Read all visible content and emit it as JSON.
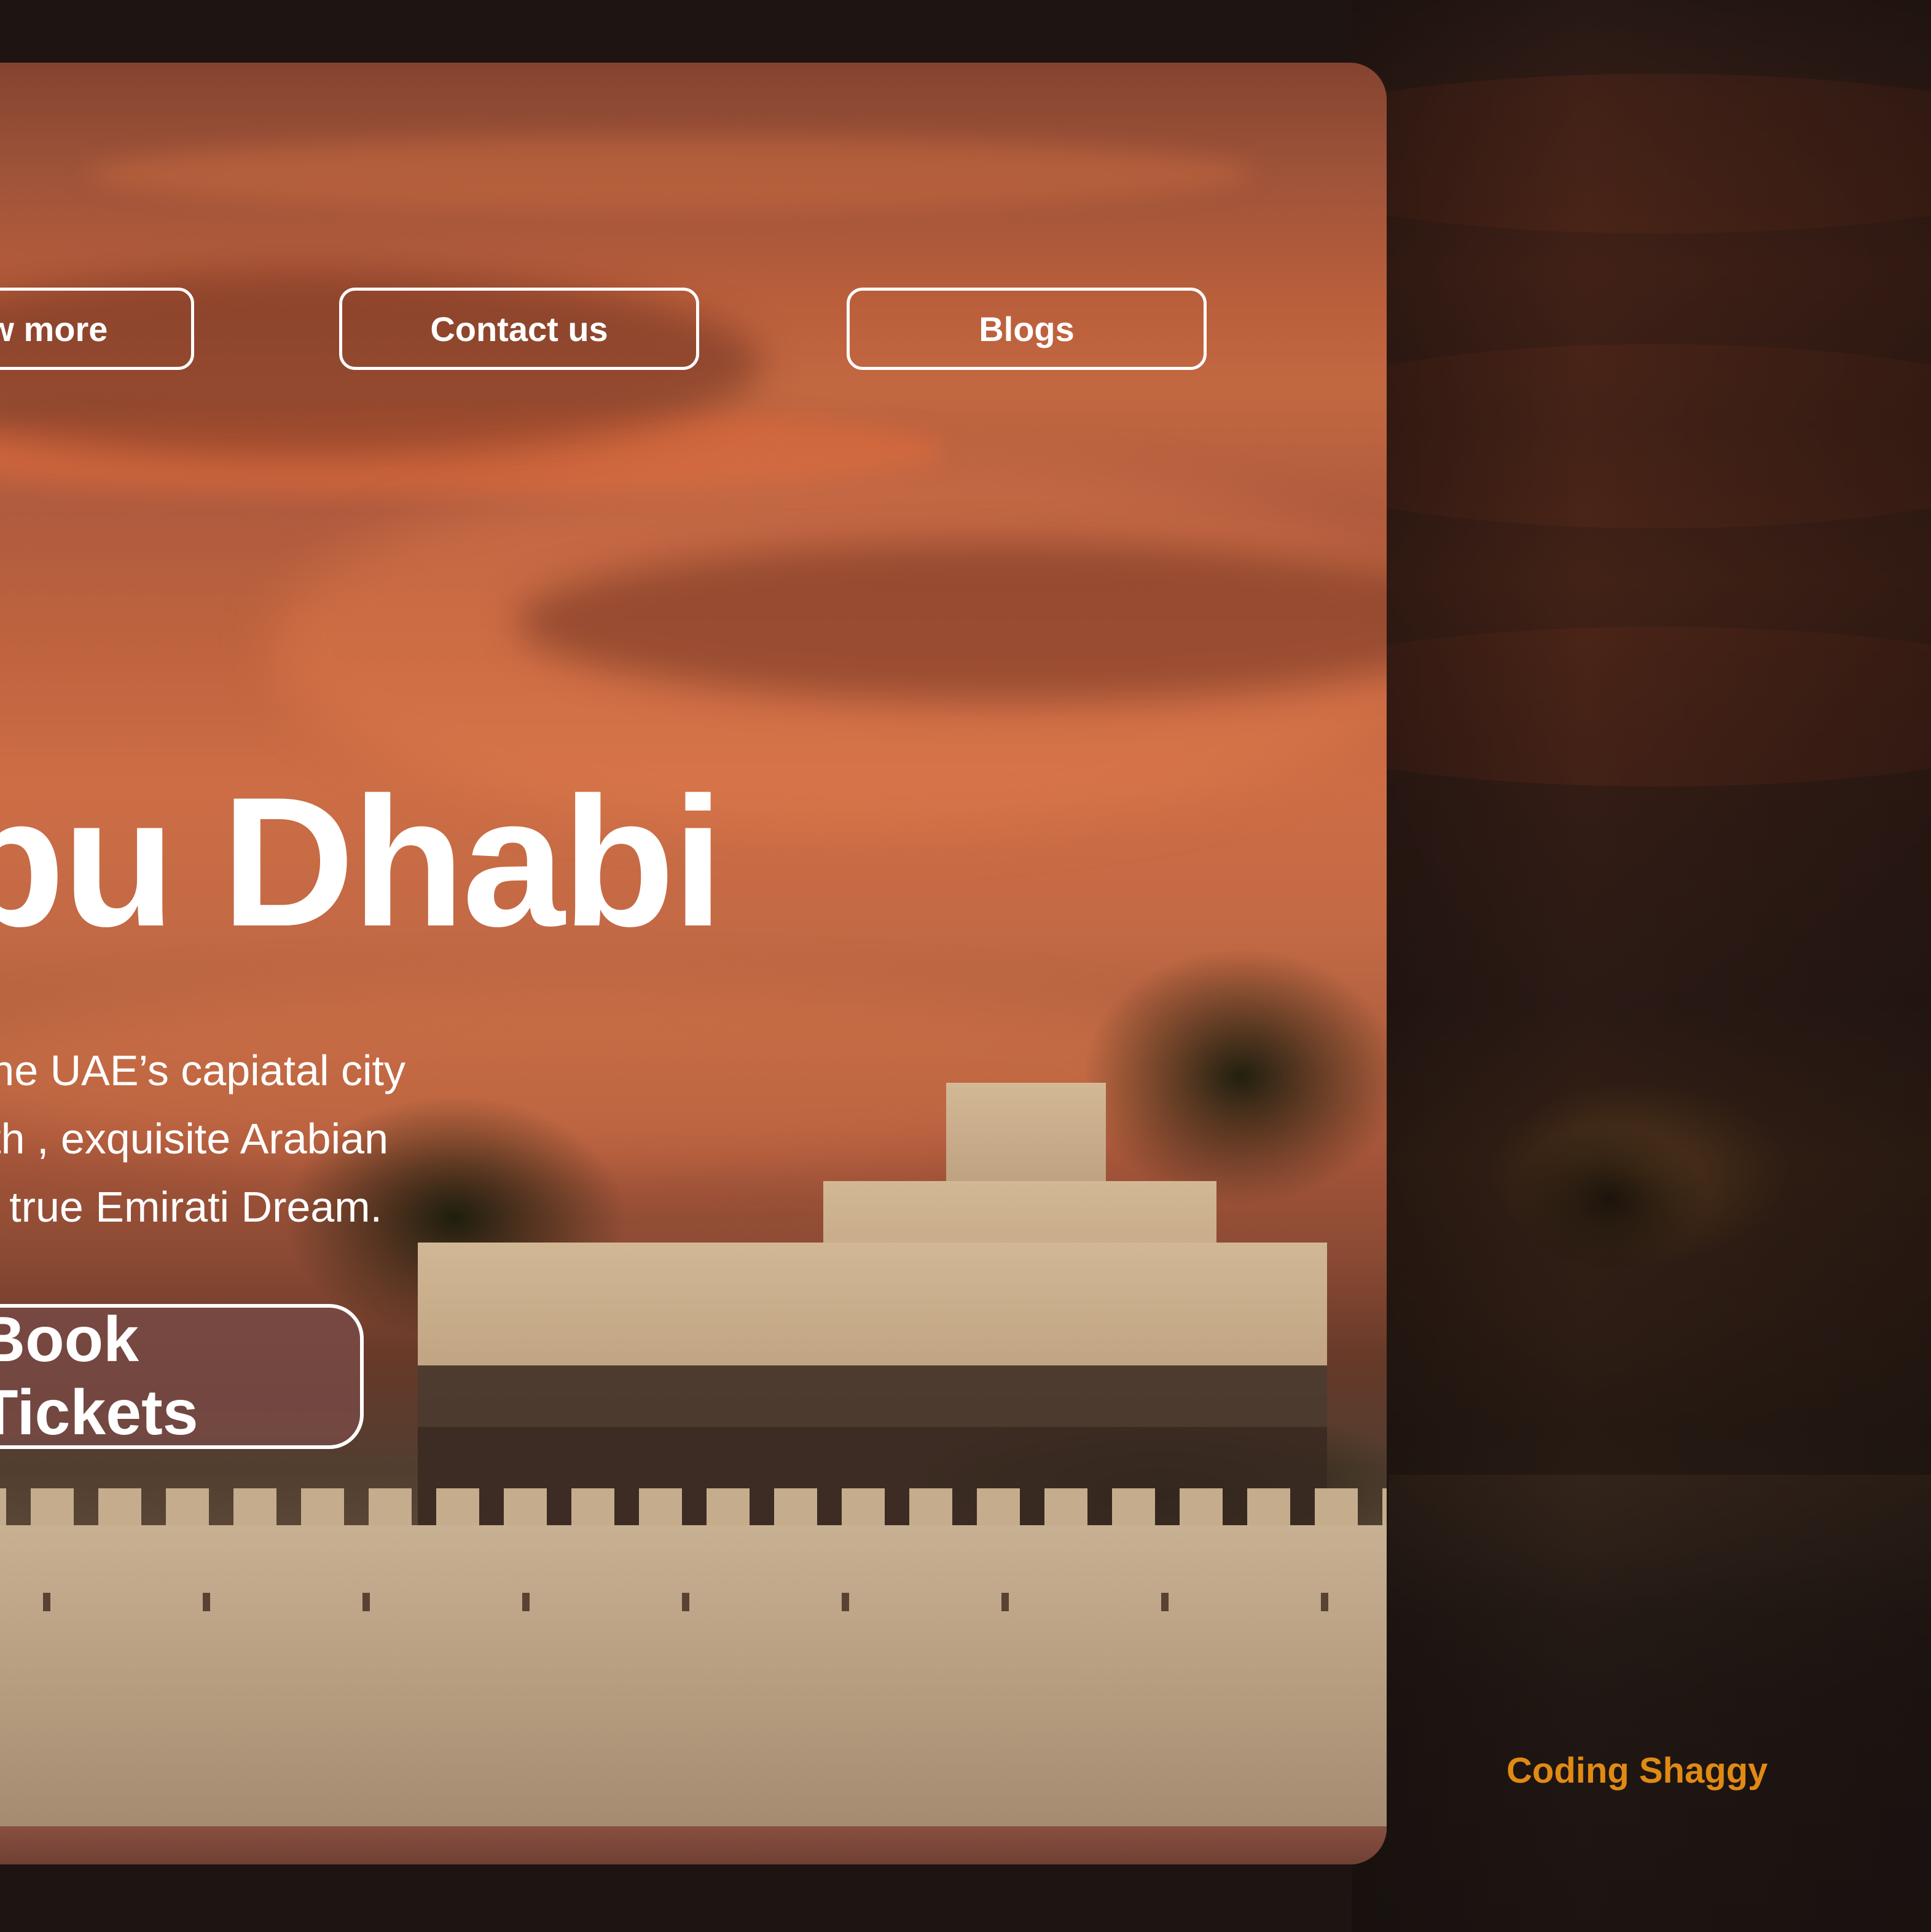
{
  "nav": {
    "know_more": "Know more",
    "contact_us": "Contact us",
    "blogs": "Blogs"
  },
  "hero": {
    "title": "Abu Dhabi",
    "description_lines": [
      "Explore the UAE’s capiatal city",
      "with , exquisite Arabian",
      "a true Emirati Dream."
    ],
    "cta_label": "Book Tickets"
  },
  "footer": {
    "credit": "Coding Shaggy"
  },
  "colors": {
    "credit_accent": "#e08a14",
    "page_background": "#1e1513",
    "button_border": "#ffffff"
  }
}
